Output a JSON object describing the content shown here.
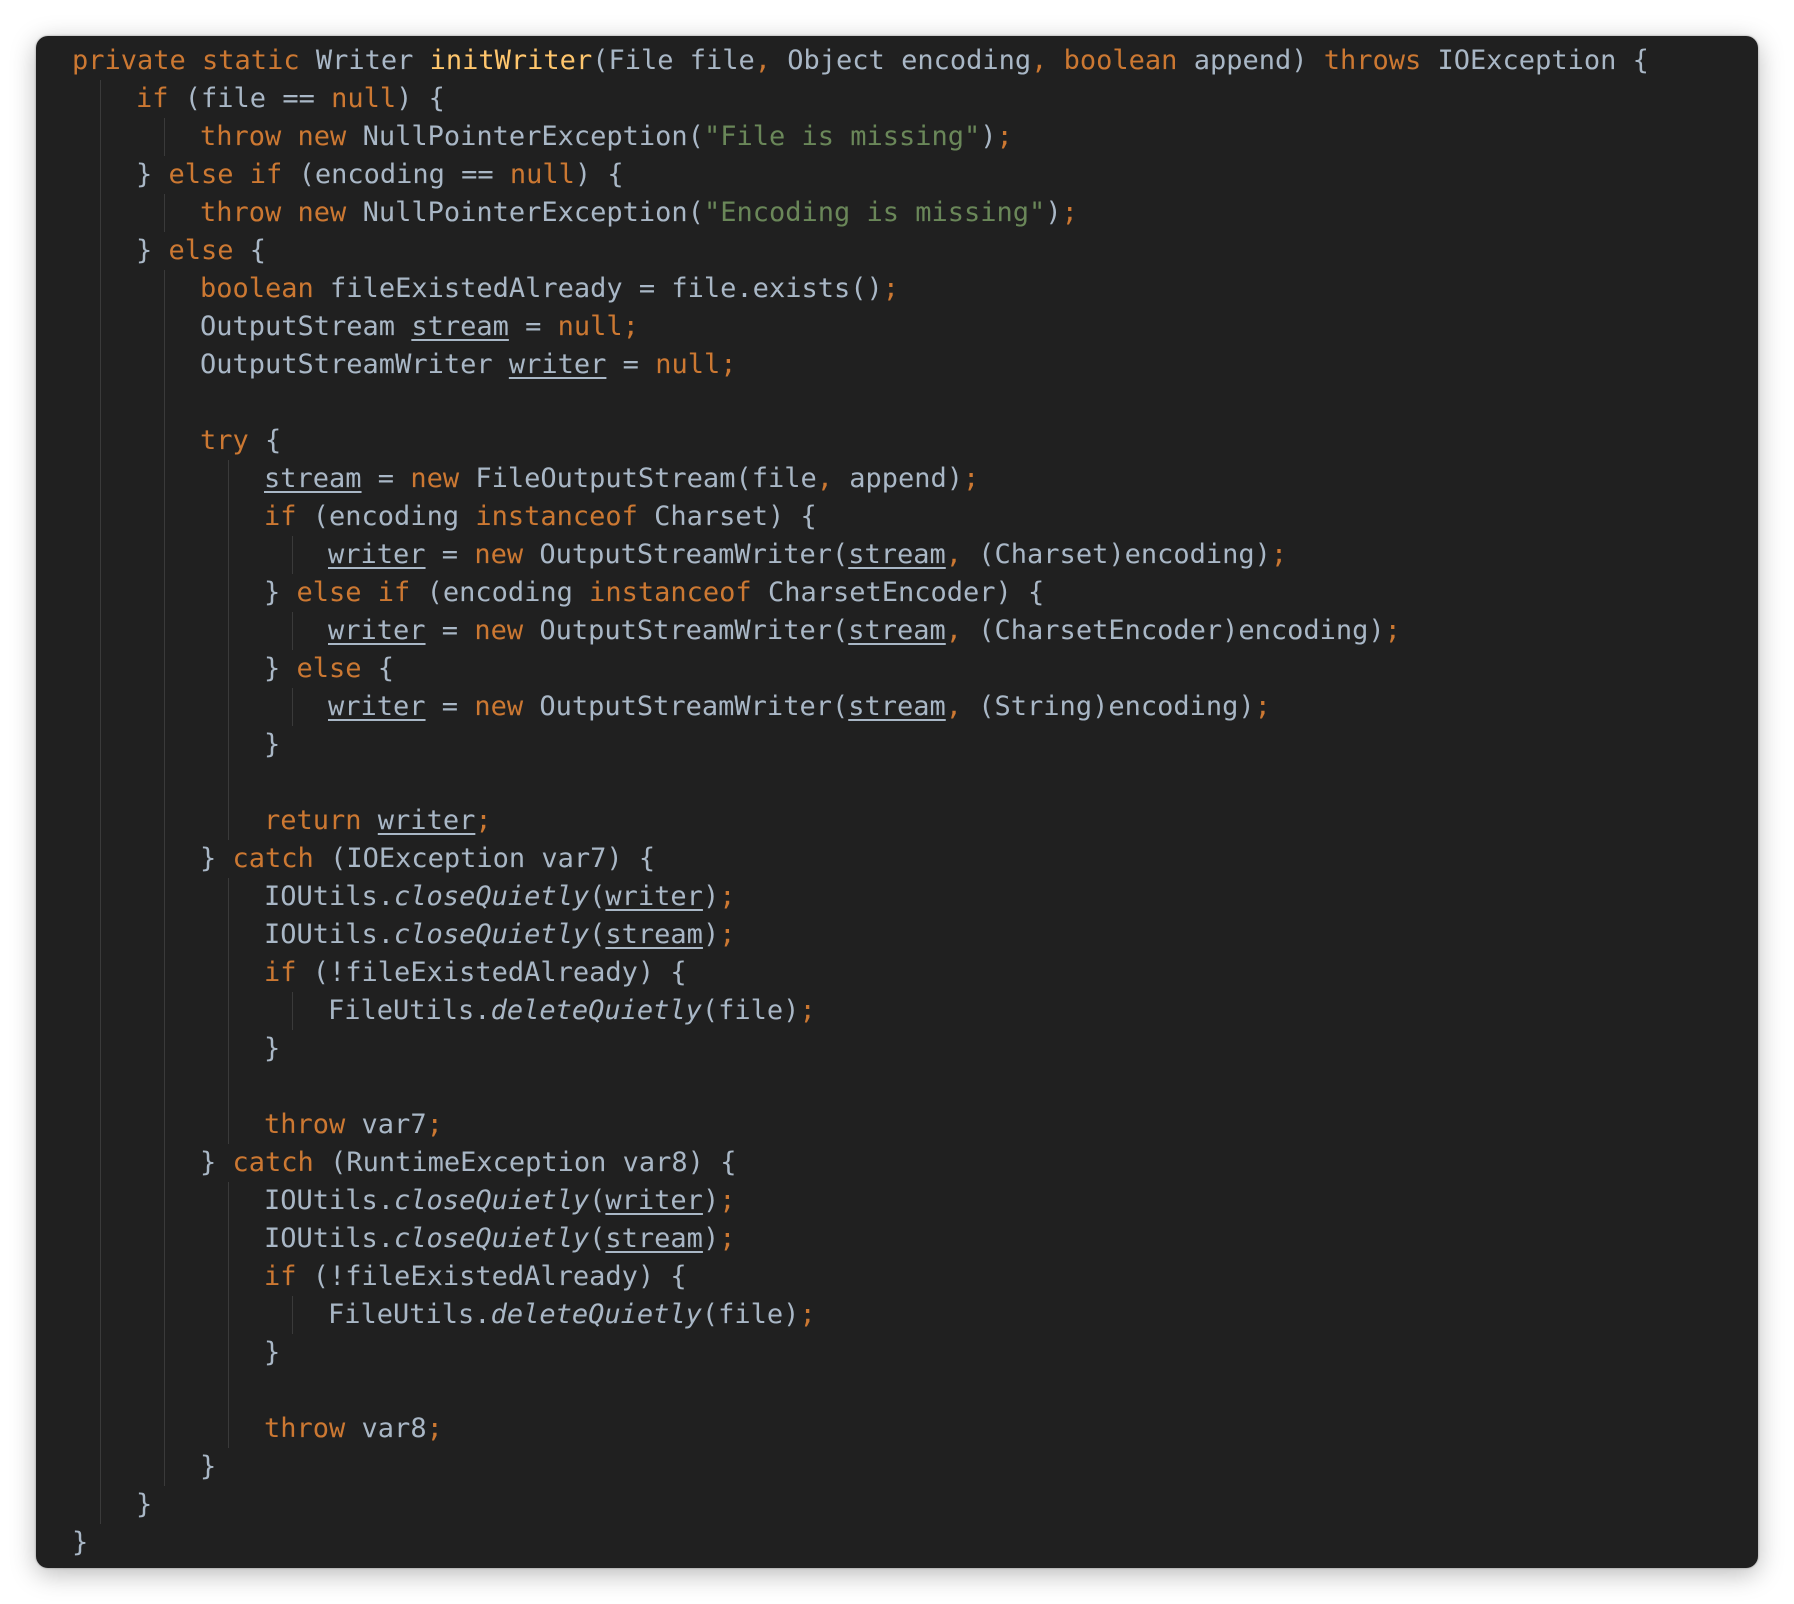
{
  "colors": {
    "background": "#202020",
    "keyword": "#cc7832",
    "method_declaration": "#ffc66d",
    "string": "#6a8759",
    "text": "#a9b7c6",
    "indent_guide": "#3a3a3a"
  },
  "code": {
    "language": "java",
    "lines": [
      {
        "indent": 0,
        "tokens": [
          [
            "private static ",
            "kw"
          ],
          [
            "Writer ",
            "pl"
          ],
          [
            "initWriter",
            "fn"
          ],
          [
            "(File file",
            "pl"
          ],
          [
            ", ",
            "kw"
          ],
          [
            "Object encoding",
            "pl"
          ],
          [
            ", ",
            "kw"
          ],
          [
            "boolean ",
            "kw"
          ],
          [
            "append) ",
            "pl"
          ],
          [
            "throws ",
            "kw"
          ],
          [
            "IOException {",
            "pl"
          ]
        ]
      },
      {
        "indent": 1,
        "tokens": [
          [
            "if ",
            "kw"
          ],
          [
            "(file == ",
            "pl"
          ],
          [
            "null",
            "kw"
          ],
          [
            ") {",
            "pl"
          ]
        ]
      },
      {
        "indent": 2,
        "tokens": [
          [
            "throw new ",
            "kw"
          ],
          [
            "NullPointerException(",
            "pl"
          ],
          [
            "\"File is missing\"",
            "str"
          ],
          [
            ")",
            "pl"
          ],
          [
            ";",
            "kw"
          ]
        ]
      },
      {
        "indent": 1,
        "tokens": [
          [
            "} ",
            "pl"
          ],
          [
            "else if ",
            "kw"
          ],
          [
            "(encoding == ",
            "pl"
          ],
          [
            "null",
            "kw"
          ],
          [
            ") {",
            "pl"
          ]
        ]
      },
      {
        "indent": 2,
        "tokens": [
          [
            "throw new ",
            "kw"
          ],
          [
            "NullPointerException(",
            "pl"
          ],
          [
            "\"Encoding is missing\"",
            "str"
          ],
          [
            ")",
            "pl"
          ],
          [
            ";",
            "kw"
          ]
        ]
      },
      {
        "indent": 1,
        "tokens": [
          [
            "} ",
            "pl"
          ],
          [
            "else ",
            "kw"
          ],
          [
            "{",
            "pl"
          ]
        ]
      },
      {
        "indent": 2,
        "tokens": [
          [
            "boolean ",
            "kw"
          ],
          [
            "fileExistedAlready = file.exists()",
            "pl"
          ],
          [
            ";",
            "kw"
          ]
        ]
      },
      {
        "indent": 2,
        "tokens": [
          [
            "OutputStream ",
            "pl"
          ],
          [
            "stream",
            "ul"
          ],
          [
            " = ",
            "pl"
          ],
          [
            "null;",
            "kw"
          ]
        ]
      },
      {
        "indent": 2,
        "tokens": [
          [
            "OutputStreamWriter ",
            "pl"
          ],
          [
            "writer",
            "ul"
          ],
          [
            " = ",
            "pl"
          ],
          [
            "null;",
            "kw"
          ]
        ]
      },
      {
        "indent": 2,
        "tokens": []
      },
      {
        "indent": 2,
        "tokens": [
          [
            "try ",
            "kw"
          ],
          [
            "{",
            "pl"
          ]
        ]
      },
      {
        "indent": 3,
        "tokens": [
          [
            "stream",
            "ul"
          ],
          [
            " = ",
            "pl"
          ],
          [
            "new ",
            "kw"
          ],
          [
            "FileOutputStream(file",
            "pl"
          ],
          [
            ", ",
            "kw"
          ],
          [
            "append)",
            "pl"
          ],
          [
            ";",
            "kw"
          ]
        ]
      },
      {
        "indent": 3,
        "tokens": [
          [
            "if ",
            "kw"
          ],
          [
            "(encoding ",
            "pl"
          ],
          [
            "instanceof ",
            "kw"
          ],
          [
            "Charset) {",
            "pl"
          ]
        ]
      },
      {
        "indent": 4,
        "tokens": [
          [
            "writer",
            "ul"
          ],
          [
            " = ",
            "pl"
          ],
          [
            "new ",
            "kw"
          ],
          [
            "OutputStreamWriter(",
            "pl"
          ],
          [
            "stream",
            "ul"
          ],
          [
            ", ",
            "kw"
          ],
          [
            "(Charset)encoding)",
            "pl"
          ],
          [
            ";",
            "kw"
          ]
        ]
      },
      {
        "indent": 3,
        "tokens": [
          [
            "} ",
            "pl"
          ],
          [
            "else if ",
            "kw"
          ],
          [
            "(encoding ",
            "pl"
          ],
          [
            "instanceof ",
            "kw"
          ],
          [
            "CharsetEncoder) {",
            "pl"
          ]
        ]
      },
      {
        "indent": 4,
        "tokens": [
          [
            "writer",
            "ul"
          ],
          [
            " = ",
            "pl"
          ],
          [
            "new ",
            "kw"
          ],
          [
            "OutputStreamWriter(",
            "pl"
          ],
          [
            "stream",
            "ul"
          ],
          [
            ", ",
            "kw"
          ],
          [
            "(CharsetEncoder)encoding)",
            "pl"
          ],
          [
            ";",
            "kw"
          ]
        ]
      },
      {
        "indent": 3,
        "tokens": [
          [
            "} ",
            "pl"
          ],
          [
            "else ",
            "kw"
          ],
          [
            "{",
            "pl"
          ]
        ]
      },
      {
        "indent": 4,
        "tokens": [
          [
            "writer",
            "ul"
          ],
          [
            " = ",
            "pl"
          ],
          [
            "new ",
            "kw"
          ],
          [
            "OutputStreamWriter(",
            "pl"
          ],
          [
            "stream",
            "ul"
          ],
          [
            ", ",
            "kw"
          ],
          [
            "(String)encoding)",
            "pl"
          ],
          [
            ";",
            "kw"
          ]
        ]
      },
      {
        "indent": 3,
        "tokens": [
          [
            "}",
            "pl"
          ]
        ]
      },
      {
        "indent": 3,
        "tokens": []
      },
      {
        "indent": 3,
        "tokens": [
          [
            "return ",
            "kw"
          ],
          [
            "writer",
            "ul"
          ],
          [
            ";",
            "kw"
          ]
        ]
      },
      {
        "indent": 2,
        "tokens": [
          [
            "} ",
            "pl"
          ],
          [
            "catch ",
            "kw"
          ],
          [
            "(IOException var7) {",
            "pl"
          ]
        ]
      },
      {
        "indent": 3,
        "tokens": [
          [
            "IOUtils.",
            "pl"
          ],
          [
            "closeQuietly",
            "it"
          ],
          [
            "(",
            "pl"
          ],
          [
            "writer",
            "ul"
          ],
          [
            ")",
            "pl"
          ],
          [
            ";",
            "kw"
          ]
        ]
      },
      {
        "indent": 3,
        "tokens": [
          [
            "IOUtils.",
            "pl"
          ],
          [
            "closeQuietly",
            "it"
          ],
          [
            "(",
            "pl"
          ],
          [
            "stream",
            "ul"
          ],
          [
            ")",
            "pl"
          ],
          [
            ";",
            "kw"
          ]
        ]
      },
      {
        "indent": 3,
        "tokens": [
          [
            "if ",
            "kw"
          ],
          [
            "(!fileExistedAlready) {",
            "pl"
          ]
        ]
      },
      {
        "indent": 4,
        "tokens": [
          [
            "FileUtils.",
            "pl"
          ],
          [
            "deleteQuietly",
            "it"
          ],
          [
            "(file)",
            "pl"
          ],
          [
            ";",
            "kw"
          ]
        ]
      },
      {
        "indent": 3,
        "tokens": [
          [
            "}",
            "pl"
          ]
        ]
      },
      {
        "indent": 3,
        "tokens": []
      },
      {
        "indent": 3,
        "tokens": [
          [
            "throw ",
            "kw"
          ],
          [
            "var7",
            "pl"
          ],
          [
            ";",
            "kw"
          ]
        ]
      },
      {
        "indent": 2,
        "tokens": [
          [
            "} ",
            "pl"
          ],
          [
            "catch ",
            "kw"
          ],
          [
            "(RuntimeException var8) {",
            "pl"
          ]
        ]
      },
      {
        "indent": 3,
        "tokens": [
          [
            "IOUtils.",
            "pl"
          ],
          [
            "closeQuietly",
            "it"
          ],
          [
            "(",
            "pl"
          ],
          [
            "writer",
            "ul"
          ],
          [
            ")",
            "pl"
          ],
          [
            ";",
            "kw"
          ]
        ]
      },
      {
        "indent": 3,
        "tokens": [
          [
            "IOUtils.",
            "pl"
          ],
          [
            "closeQuietly",
            "it"
          ],
          [
            "(",
            "pl"
          ],
          [
            "stream",
            "ul"
          ],
          [
            ")",
            "pl"
          ],
          [
            ";",
            "kw"
          ]
        ]
      },
      {
        "indent": 3,
        "tokens": [
          [
            "if ",
            "kw"
          ],
          [
            "(!fileExistedAlready) {",
            "pl"
          ]
        ]
      },
      {
        "indent": 4,
        "tokens": [
          [
            "FileUtils.",
            "pl"
          ],
          [
            "deleteQuietly",
            "it"
          ],
          [
            "(file)",
            "pl"
          ],
          [
            ";",
            "kw"
          ]
        ]
      },
      {
        "indent": 3,
        "tokens": [
          [
            "}",
            "pl"
          ]
        ]
      },
      {
        "indent": 3,
        "tokens": []
      },
      {
        "indent": 3,
        "tokens": [
          [
            "throw ",
            "kw"
          ],
          [
            "var8",
            "pl"
          ],
          [
            ";",
            "kw"
          ]
        ]
      },
      {
        "indent": 2,
        "tokens": [
          [
            "}",
            "pl"
          ]
        ]
      },
      {
        "indent": 1,
        "tokens": [
          [
            "}",
            "pl"
          ]
        ]
      },
      {
        "indent": 0,
        "tokens": [
          [
            "}",
            "pl"
          ]
        ]
      }
    ]
  }
}
